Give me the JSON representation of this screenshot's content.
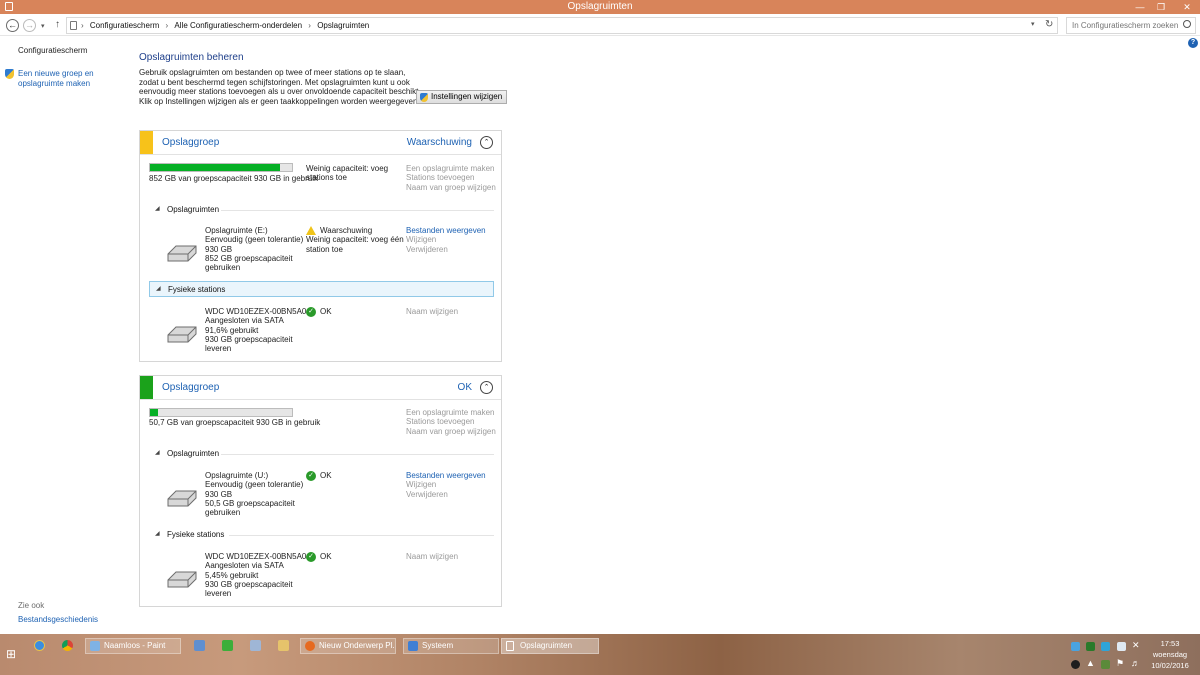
{
  "window": {
    "title": "Opslagruimten"
  },
  "address": {
    "crumbs": [
      "Configuratiescherm",
      "Alle Configuratiescherm-onderdelen",
      "Opslagruimten"
    ],
    "separator": "›",
    "search_placeholder": "In Configuratiescherm zoeken"
  },
  "sidebar": {
    "home": "Configuratiescherm",
    "new_group_line1": "Een nieuwe groep en",
    "new_group_line2": "opslagruimte maken",
    "see_also": "Zie ook",
    "file_history": "Bestandsgeschiedenis"
  },
  "main": {
    "heading": "Opslagruimten beheren",
    "intro": [
      "Gebruik opslagruimten om bestanden op twee of meer stations op te slaan,",
      "zodat u bent beschermd tegen schijfstoringen. Met opslagruimten kunt u ook",
      "eenvoudig meer stations toevoegen als u over onvoldoende capaciteit beschikt.",
      "Klik op Instellingen wijzigen als er geen taakkoppelingen worden weergegeven."
    ],
    "change_settings": "Instellingen wijzigen"
  },
  "groups": [
    {
      "title": "Opslaggroep",
      "status": "Waarschuwing",
      "stripe_color": "#f7c21a",
      "usage_fraction": 0.916,
      "usage_text": "852 GB van groepscapaciteit 930 GB in gebruik",
      "capacity_note": [
        "Weinig capaciteit: voeg",
        "stations toe"
      ],
      "actions": [
        "Een opslagruimte maken",
        "Stations toevoegen",
        "Naam van groep wijzigen"
      ],
      "spaces_label": "Opslagruimten",
      "space": {
        "lines": [
          "Opslagruimte (E:)",
          "Eenvoudig (geen tolerantie)",
          "930 GB",
          "852 GB groepscapaciteit",
          "gebruiken"
        ],
        "status": "Waarschuwing",
        "status_detail": [
          "Weinig capaciteit: voeg één",
          "station toe"
        ],
        "icon": "warning-icon",
        "actions": [
          "Bestanden weergeven",
          "Wijzigen",
          "Verwijderen"
        ]
      },
      "disks_label": "Fysieke stations",
      "disk": {
        "lines": [
          "WDC WD10EZEX-00BN5A0",
          "Aangesloten via SATA",
          "91,6% gebruikt",
          "930 GB groepscapaciteit",
          "leveren"
        ],
        "status": "OK",
        "action": "Naam wijzigen"
      }
    },
    {
      "title": "Opslaggroep",
      "status": "OK",
      "stripe_color": "#1ba21b",
      "usage_fraction": 0.0545,
      "usage_text": "50,7 GB van groepscapaciteit 930 GB in gebruik",
      "actions": [
        "Een opslagruimte maken",
        "Stations toevoegen",
        "Naam van groep wijzigen"
      ],
      "spaces_label": "Opslagruimten",
      "space": {
        "lines": [
          "Opslagruimte (U:)",
          "Eenvoudig (geen tolerantie)",
          "930 GB",
          "50,5 GB groepscapaciteit",
          "gebruiken"
        ],
        "status": "OK",
        "actions": [
          "Bestanden weergeven",
          "Wijzigen",
          "Verwijderen"
        ]
      },
      "disks_label": "Fysieke stations",
      "disk": {
        "lines": [
          "WDC WD10EZEX-00BN5A0",
          "Aangesloten via SATA",
          "5,45% gebruikt",
          "930 GB groepscapaciteit",
          "leveren"
        ],
        "status": "OK",
        "action": "Naam wijzigen"
      }
    }
  ],
  "taskbar": {
    "buttons": [
      "Naamloos - Paint",
      "Nieuw Onderwerp Pl...",
      "Systeem",
      "Opslagruimten"
    ],
    "time": "17:53",
    "day": "woensdag",
    "date": "10/02/2016"
  }
}
